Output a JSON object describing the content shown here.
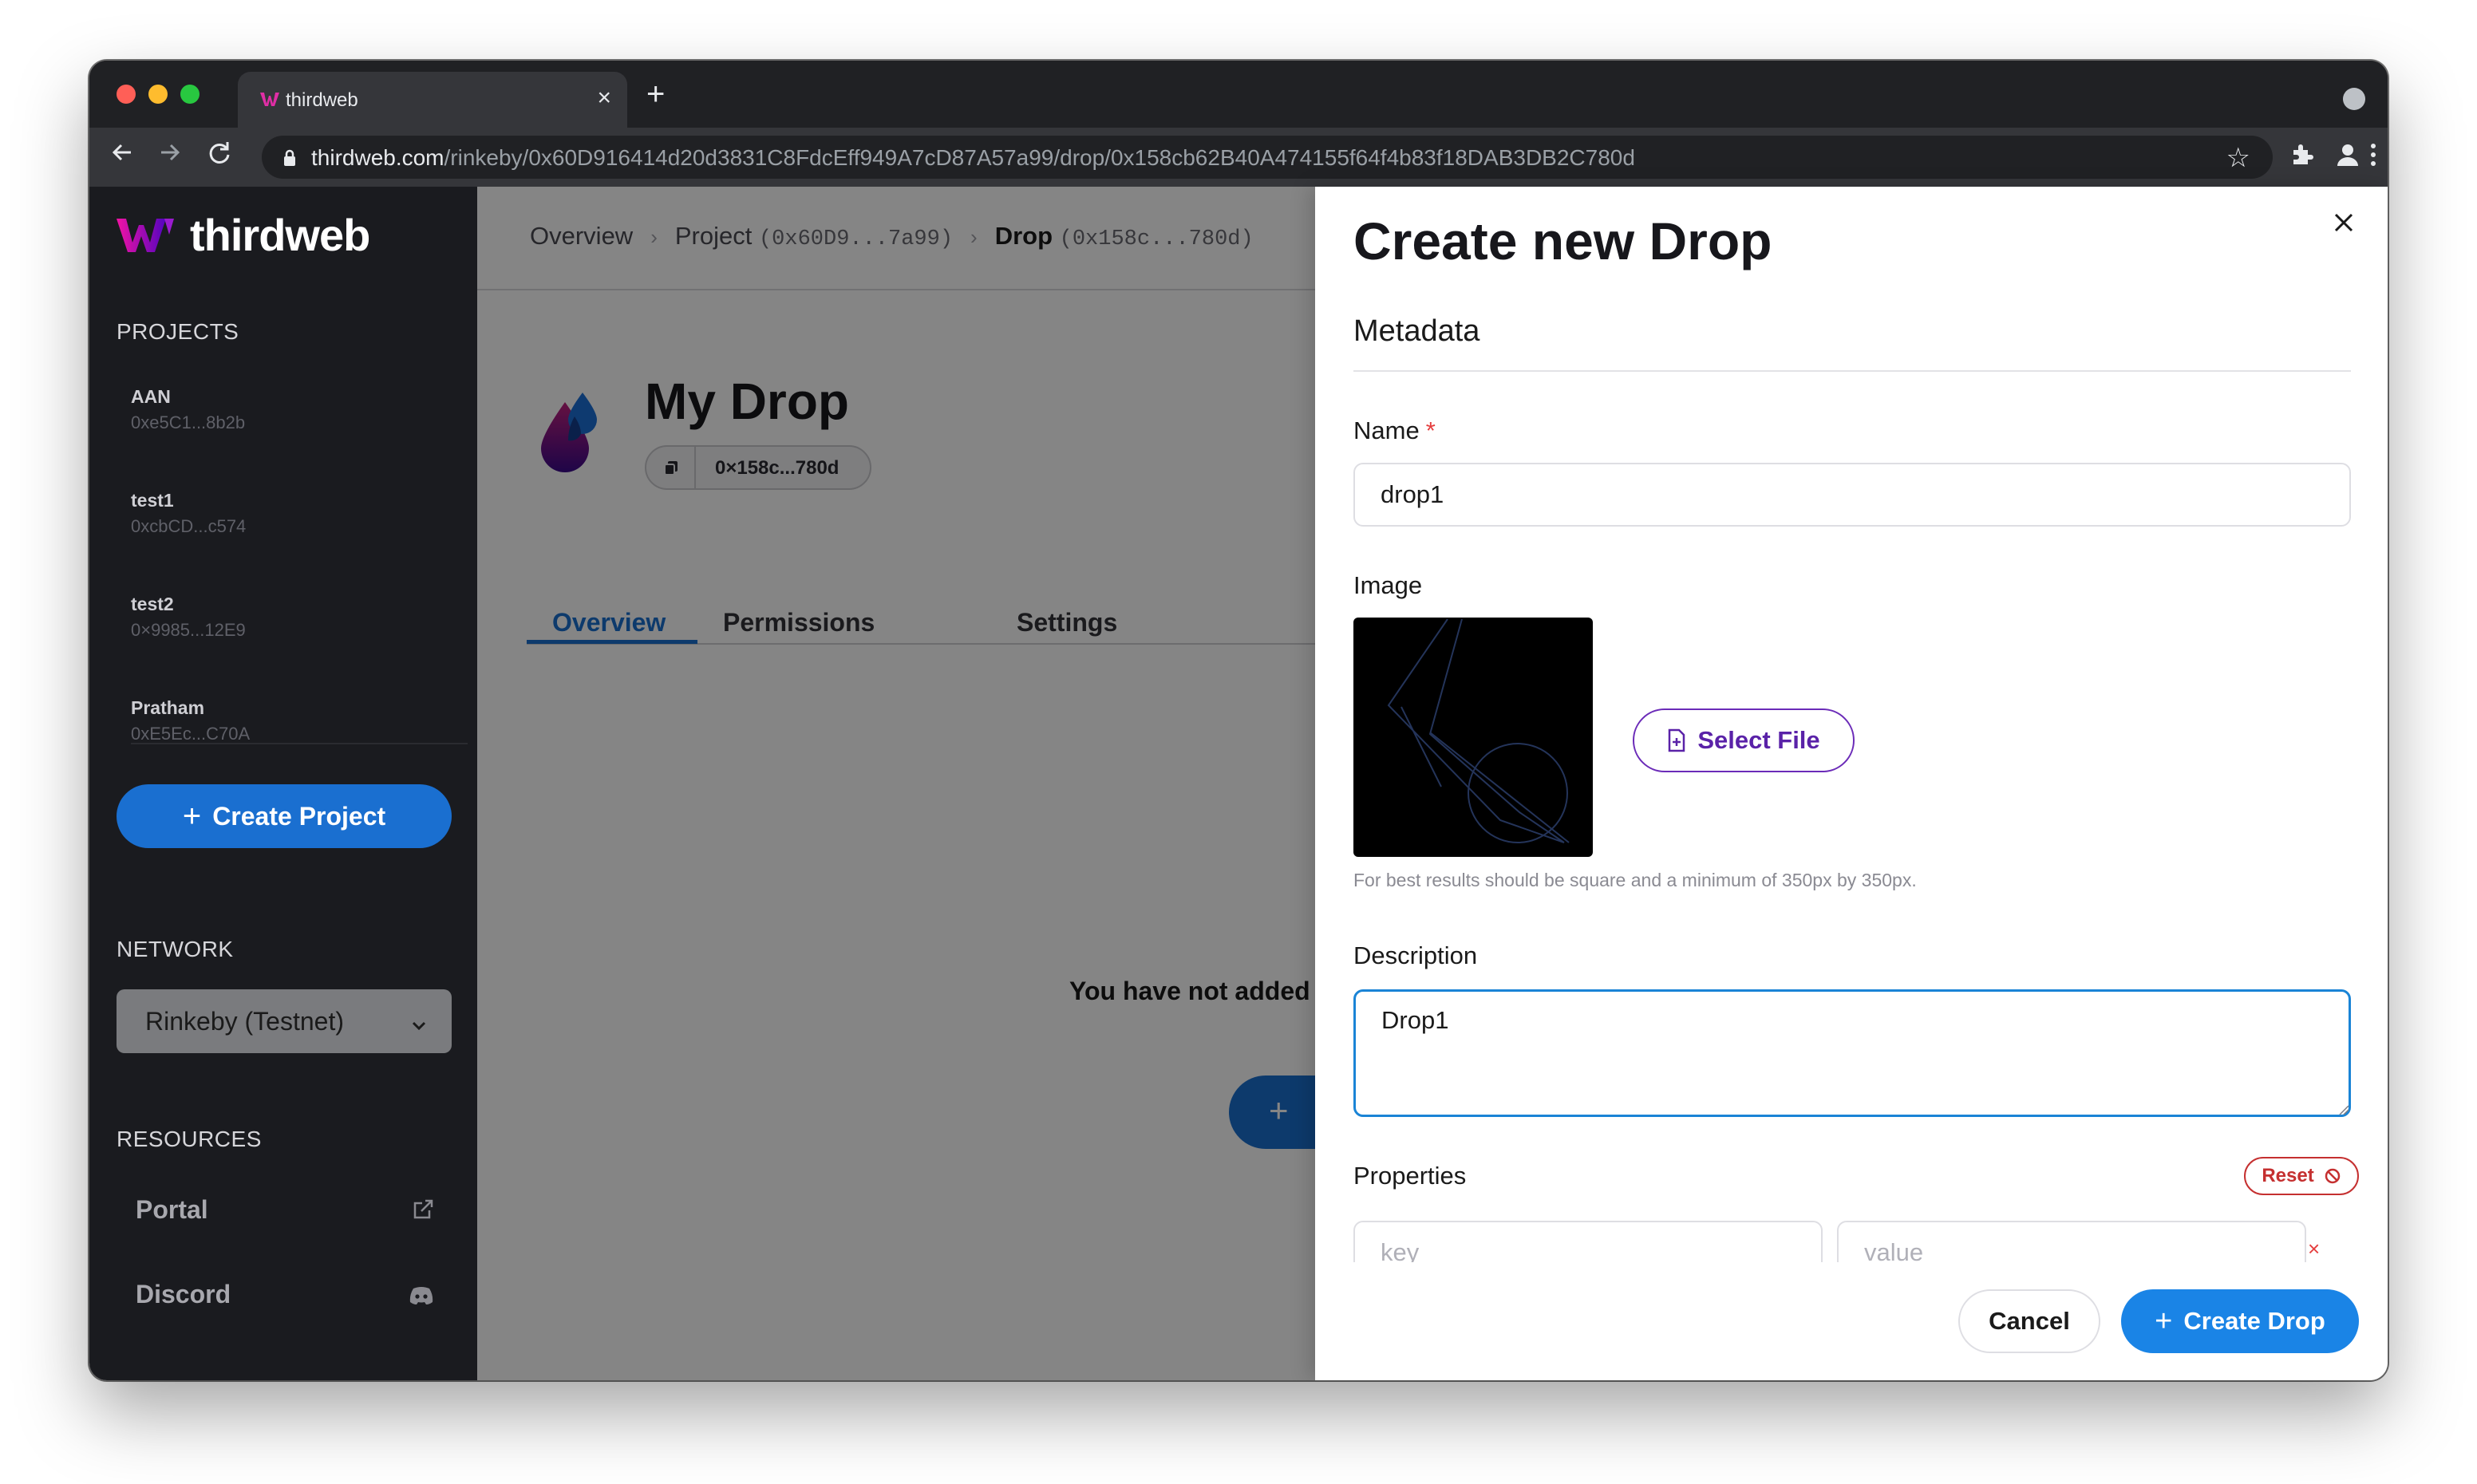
{
  "browser": {
    "tab_title": "thirdweb",
    "tab_close": "×",
    "new_tab": "+",
    "url_host": "thirdweb.com",
    "url_path": "/rinkeby/0x60D916414d20d3831C8FdcEff949A7cD87A57a99/drop/0x158cb62B40A474155f64f4b83f18DAB3DB2C780d"
  },
  "sidebar": {
    "logo": "thirdweb",
    "projects_heading": "PROJECTS",
    "projects": [
      {
        "name": "AAN",
        "address": "0xe5C1...8b2b"
      },
      {
        "name": "test1",
        "address": "0xcbCD...c574"
      },
      {
        "name": "test2",
        "address": "0×9985...12E9"
      },
      {
        "name": "Pratham",
        "address": "0xE5Ec...C70A"
      }
    ],
    "create_project": "Create Project",
    "network_heading": "NETWORK",
    "network_value": "Rinkeby (Testnet)",
    "resources_heading": "RESOURCES",
    "resources": [
      {
        "label": "Portal",
        "icon": "external-link-icon"
      },
      {
        "label": "Discord",
        "icon": "discord-icon"
      }
    ]
  },
  "main": {
    "breadcrumb": {
      "overview": "Overview",
      "project": "Project",
      "project_addr": "(0x60D9...7a99)",
      "drop": "Drop",
      "drop_addr": "(0x158c...780d)"
    },
    "title": "My Drop",
    "address": "0×158c...780d",
    "tabs": [
      "Overview",
      "Permissions",
      "Settings"
    ],
    "empty_text": "You have not added a",
    "add_button_glyph": "+"
  },
  "drawer": {
    "title": "Create new Drop",
    "metadata_heading": "Metadata",
    "name_label": "Name",
    "required_mark": "*",
    "name_value": "drop1",
    "image_label": "Image",
    "select_file": "Select File",
    "image_help": "For best results should be square and a minimum of 350px by 350px.",
    "description_label": "Description",
    "description_value": "Drop1",
    "properties_label": "Properties",
    "reset": "Reset",
    "key_placeholder": "key",
    "value_placeholder": "value",
    "remove_glyph": "×",
    "cancel": "Cancel",
    "create": "Create Drop"
  },
  "colors": {
    "primary": "#1a84e6",
    "sidebar_bg": "#1a1b1f",
    "select_file": "#5a22a8",
    "danger": "#c53030"
  }
}
